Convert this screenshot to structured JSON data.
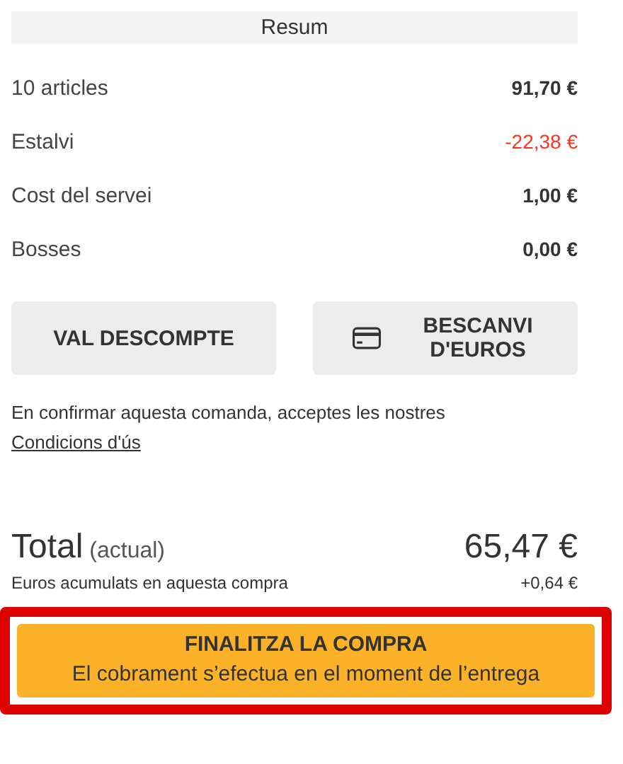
{
  "header": "Resum",
  "lines": [
    {
      "label": "10 articles",
      "amount": "91,70 €",
      "kind": "normal"
    },
    {
      "label": "Estalvi",
      "amount": "-22,38 €",
      "kind": "saving"
    },
    {
      "label": "Cost del servei",
      "amount": "1,00 €",
      "kind": "normal"
    },
    {
      "label": "Bosses",
      "amount": "0,00 €",
      "kind": "normal"
    }
  ],
  "buttons": [
    {
      "label": "VAL DESCOMPTE",
      "kind": "plain"
    },
    {
      "label": "BESCANVI D'EUROS",
      "kind": "card"
    }
  ],
  "terms": {
    "text": "En confirmar aquesta comanda, acceptes les nostres",
    "link": "Condicions d'ús"
  },
  "total": {
    "label": "Total",
    "note": "(actual)",
    "amount": "65,47 €"
  },
  "earned": {
    "label": "Euros acumulats en aquesta compra",
    "amount": "+0,64 €"
  },
  "checkout": {
    "title": "FINALITZA LA COMPRA",
    "subtitle": "El cobrament s’efectua en el moment de l’entrega",
    "highlighted": true
  }
}
